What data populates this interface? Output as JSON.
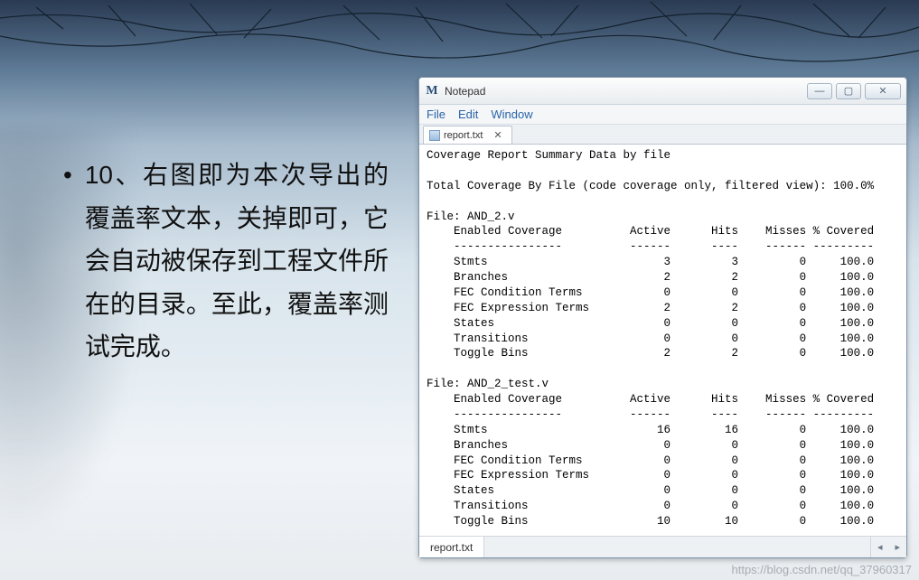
{
  "slide": {
    "bullet_marker": "•",
    "text": "10、右图即为本次导出的覆盖率文本，关掉即可，它会自动被保存到工程文件所在的目录。至此，覆盖率测试完成。"
  },
  "window": {
    "icon_char": "M",
    "title": "Notepad",
    "menu": {
      "file": "File",
      "edit": "Edit",
      "window": "Window"
    },
    "tab_label": "report.txt",
    "tab_close": "✕",
    "btn_min": "—",
    "btn_max": "▢",
    "btn_close": "✕",
    "status_tab": "report.txt",
    "scroll_left": "◂",
    "scroll_right": "▸"
  },
  "report": {
    "header1": "Coverage Report Summary Data by file",
    "header2": "Total Coverage By File (code coverage only, filtered view): 100.0%",
    "col": {
      "cov": "Enabled Coverage",
      "active": "Active",
      "hits": "Hits",
      "misses": "Misses",
      "pct": "% Covered"
    },
    "files": [
      {
        "name": "File: AND_2.v",
        "rows": [
          {
            "label": "Stmts",
            "active": 3,
            "hits": 3,
            "misses": 0,
            "pct": "100.0"
          },
          {
            "label": "Branches",
            "active": 2,
            "hits": 2,
            "misses": 0,
            "pct": "100.0"
          },
          {
            "label": "FEC Condition Terms",
            "active": 0,
            "hits": 0,
            "misses": 0,
            "pct": "100.0"
          },
          {
            "label": "FEC Expression Terms",
            "active": 2,
            "hits": 2,
            "misses": 0,
            "pct": "100.0"
          },
          {
            "label": "States",
            "active": 0,
            "hits": 0,
            "misses": 0,
            "pct": "100.0"
          },
          {
            "label": "Transitions",
            "active": 0,
            "hits": 0,
            "misses": 0,
            "pct": "100.0"
          },
          {
            "label": "Toggle Bins",
            "active": 2,
            "hits": 2,
            "misses": 0,
            "pct": "100.0"
          }
        ]
      },
      {
        "name": "File: AND_2_test.v",
        "rows": [
          {
            "label": "Stmts",
            "active": 16,
            "hits": 16,
            "misses": 0,
            "pct": "100.0"
          },
          {
            "label": "Branches",
            "active": 0,
            "hits": 0,
            "misses": 0,
            "pct": "100.0"
          },
          {
            "label": "FEC Condition Terms",
            "active": 0,
            "hits": 0,
            "misses": 0,
            "pct": "100.0"
          },
          {
            "label": "FEC Expression Terms",
            "active": 0,
            "hits": 0,
            "misses": 0,
            "pct": "100.0"
          },
          {
            "label": "States",
            "active": 0,
            "hits": 0,
            "misses": 0,
            "pct": "100.0"
          },
          {
            "label": "Transitions",
            "active": 0,
            "hits": 0,
            "misses": 0,
            "pct": "100.0"
          },
          {
            "label": "Toggle Bins",
            "active": 10,
            "hits": 10,
            "misses": 0,
            "pct": "100.0"
          }
        ]
      }
    ]
  },
  "watermark": "https://blog.csdn.net/qq_37960317"
}
